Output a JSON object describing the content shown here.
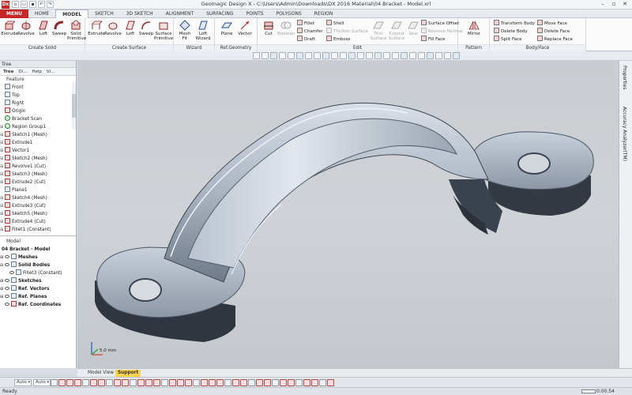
{
  "window": {
    "logo_text": "Dx",
    "title": "Geomagic Design X - C:\\Users\\Admin\\Downloads\\DX 2016 Material\\04 Bracket - Model.xrl"
  },
  "menubar": {
    "tabs": [
      "MENU",
      "HOME",
      "MODEL",
      "SKETCH",
      "3D SKETCH",
      "ALIGNMENT",
      "SURFACING",
      "POINTS",
      "POLYGONS",
      "REGION"
    ],
    "active": "MODEL"
  },
  "ribbon": {
    "create_solid": {
      "label": "Create Solid",
      "buttons": [
        "Extrude",
        "Revolve",
        "Loft",
        "Sweep",
        "Solid Primitive"
      ]
    },
    "create_surface": {
      "label": "Create Surface",
      "buttons": [
        "Extrude",
        "Revolve",
        "Loft",
        "Sweep",
        "Surface Primitive"
      ]
    },
    "wizard": {
      "label": "Wizard",
      "buttons": [
        "Mesh Fit",
        "Loft Wizard"
      ]
    },
    "ref_geometry": {
      "label": "Ref.Geometry",
      "buttons": [
        "Plane",
        "Vector"
      ]
    },
    "edit": {
      "label": "Edit",
      "big_buttons": [
        "Cut",
        "Boolean"
      ],
      "col1": [
        "Fillet",
        "Chamfer",
        "Draft"
      ],
      "col2": [
        "Shell",
        "Thicken Surface",
        "Emboss"
      ],
      "mid_buttons": [
        "Trim Surface",
        "Extend Surface",
        "Sew"
      ],
      "col3": [
        "Surface Offset",
        "Reverse Normal",
        "Fill Face"
      ]
    },
    "pattern": {
      "label": "Pattern",
      "buttons": [
        "Mirror"
      ]
    },
    "body_face": {
      "label": "Body/Face",
      "col1": [
        "Transform Body",
        "Delete Body",
        "Split Face"
      ],
      "col2": [
        "Move Face",
        "Delete Face",
        "Replace Face"
      ]
    }
  },
  "left_panel": {
    "title": "Tree",
    "tabs": [
      "Tree",
      "Di...",
      "Help",
      "Vi..."
    ],
    "feature_label": "Feature",
    "features": [
      {
        "name": "Front",
        "icon": "plane"
      },
      {
        "name": "Top",
        "icon": "plane"
      },
      {
        "name": "Right",
        "icon": "plane"
      },
      {
        "name": "Origin",
        "icon": "origin"
      },
      {
        "name": "Bracket Scan",
        "icon": "mesh"
      },
      {
        "name": "Region Group1",
        "icon": "region"
      },
      {
        "name": "Sketch1 (Mesh)",
        "icon": "sketch"
      },
      {
        "name": "Extrude1",
        "icon": "extrude"
      },
      {
        "name": "Vector1",
        "icon": "vector"
      },
      {
        "name": "Sketch2 (Mesh)",
        "icon": "sketch"
      },
      {
        "name": "Revolve1 (Cut)",
        "icon": "revolve"
      },
      {
        "name": "Sketch3 (Mesh)",
        "icon": "sketch"
      },
      {
        "name": "Extrude2 (Cut)",
        "icon": "extrude"
      },
      {
        "name": "Plane1",
        "icon": "plane"
      },
      {
        "name": "Sketch4 (Mesh)",
        "icon": "sketch"
      },
      {
        "name": "Extrude3 (Cut)",
        "icon": "extrude"
      },
      {
        "name": "Sketch5 (Mesh)",
        "icon": "sketch"
      },
      {
        "name": "Extrude4 (Cut)",
        "icon": "extrude"
      },
      {
        "name": "Fillet1 (Constant)",
        "icon": "fillet"
      }
    ],
    "model_label": "Model",
    "model_root": "04 Bracket - Model",
    "model_items": [
      {
        "name": "Meshes",
        "level": 0
      },
      {
        "name": "Solid Bodies",
        "level": 0
      },
      {
        "name": "Fillet3 (Constant)",
        "level": 1
      },
      {
        "name": "Sketches",
        "level": 0
      },
      {
        "name": "Ref. Vectors",
        "level": 0
      },
      {
        "name": "Ref. Planes",
        "level": 0
      },
      {
        "name": "Ref. Coordinates",
        "level": 0
      }
    ]
  },
  "viewport": {
    "scale_label": "5.0 mm"
  },
  "right_panel": {
    "tabs": [
      "Properties",
      "Accuracy Analyzer(TM)"
    ]
  },
  "bottom_tabs": {
    "tabs": [
      "Model View",
      "Support"
    ],
    "active": "Support"
  },
  "bottom_toolbar": {
    "combo1": "Auto",
    "combo2": "Auto"
  },
  "statusbar": {
    "text": "Ready",
    "time": "0:00:54"
  }
}
